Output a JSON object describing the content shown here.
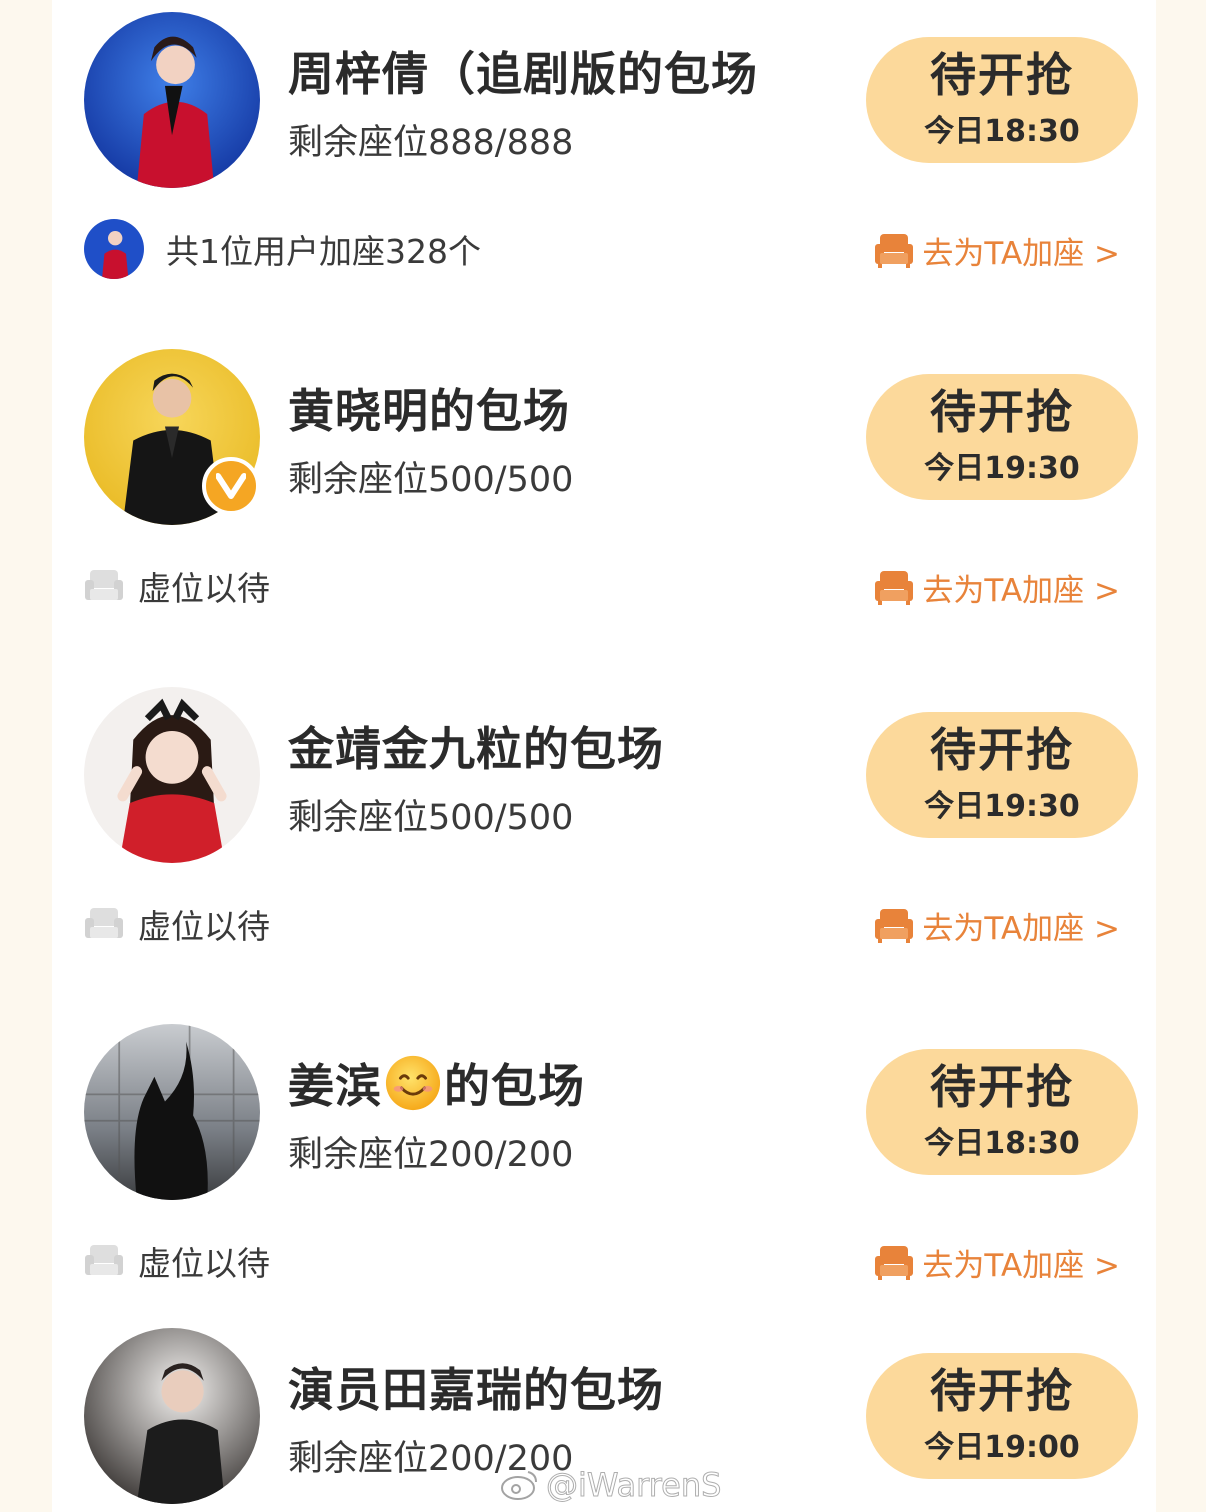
{
  "colors": {
    "accent": "#e8833a",
    "button_bg": "#fcd99b",
    "page_bg": "#fdf8ee"
  },
  "add_seat_label": "去为TA加座 >",
  "cards": [
    {
      "title": "周梓倩（追剧版的包场",
      "seats": "剩余座位888/888",
      "button_label": "待开抢",
      "button_time": "今日18:30",
      "footer": "共1位用户加座328个",
      "footer_type": "avatar"
    },
    {
      "title": "黄晓明的包场",
      "seats": "剩余座位500/500",
      "button_label": "待开抢",
      "button_time": "今日19:30",
      "footer": "虚位以待",
      "footer_type": "empty",
      "verified": true
    },
    {
      "title": "金靖金九粒的包场",
      "seats": "剩余座位500/500",
      "button_label": "待开抢",
      "button_time": "今日19:30",
      "footer": "虚位以待",
      "footer_type": "empty"
    },
    {
      "title_pre": "姜滨",
      "title_post": "的包场",
      "seats": "剩余座位200/200",
      "button_label": "待开抢",
      "button_time": "今日18:30",
      "footer": "虚位以待",
      "footer_type": "empty"
    },
    {
      "title": "演员田嘉瑞的包场",
      "seats": "剩余座位200/200",
      "button_label": "待开抢",
      "button_time": "今日19:00"
    }
  ],
  "watermark": "@iWarrenS"
}
